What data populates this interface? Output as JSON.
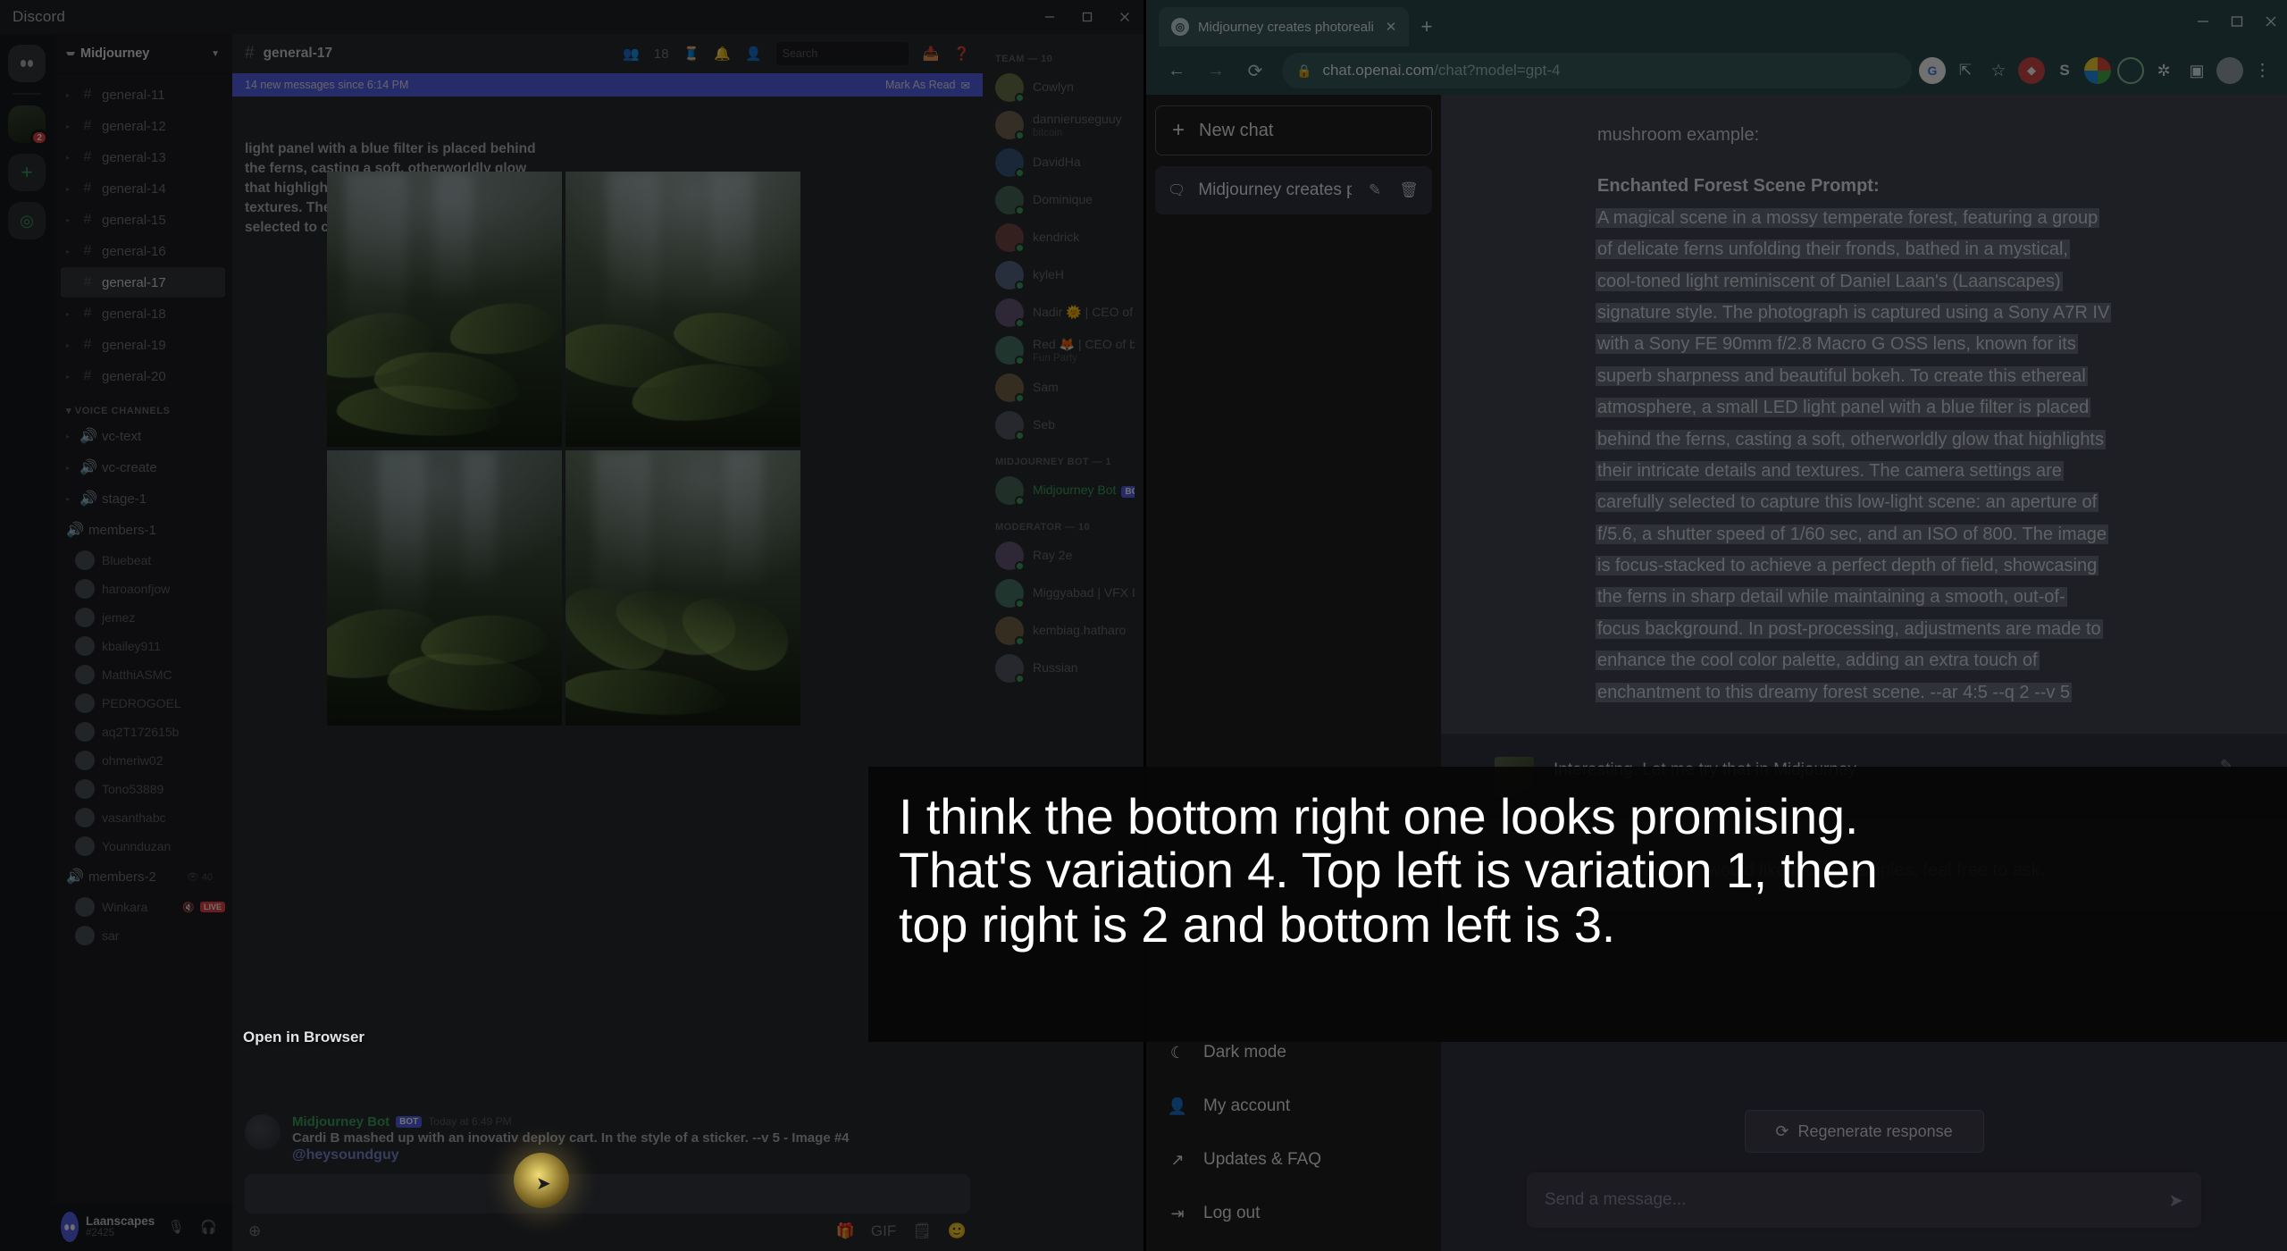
{
  "discord": {
    "window_title": "Discord",
    "window_buttons": [
      "minimize",
      "maximize",
      "close"
    ],
    "server_name": "Midjourney",
    "guild_badge_count": "2",
    "channels_header": "",
    "text_channels": [
      {
        "name": "general-11"
      },
      {
        "name": "general-12"
      },
      {
        "name": "general-13"
      },
      {
        "name": "general-14"
      },
      {
        "name": "general-15"
      },
      {
        "name": "general-16"
      },
      {
        "name": "general-17",
        "active": true
      },
      {
        "name": "general-18"
      },
      {
        "name": "general-19"
      },
      {
        "name": "general-20"
      }
    ],
    "voice_category": "VOICE CHANNELS",
    "voice_channels": [
      {
        "name": "vc-text"
      },
      {
        "name": "vc-create"
      },
      {
        "name": "stage-1"
      }
    ],
    "voice_group_1": {
      "name": "members-1",
      "members": [
        "Bluebeat",
        "haroaonfjow",
        "jemez",
        "kbailey911",
        "MatthiASMC",
        "PEDROGOEL",
        "aq2T172615b",
        "ohmeriw02",
        "Tono53889",
        "vasanthabc",
        "Younnduzan"
      ]
    },
    "voice_group_2": {
      "name": "members-2",
      "count": "40",
      "members": [
        {
          "name": "Winkara",
          "live": "LIVE"
        },
        {
          "name": "sar"
        }
      ]
    },
    "user_panel": {
      "name": "Laanscapes",
      "tag": "#2425",
      "icons": [
        "mic-icon",
        "headset-icon",
        "gear-icon"
      ]
    },
    "channel_header": {
      "name": "general-17",
      "member_count": "18",
      "search_placeholder": "Search"
    },
    "new_messages_banner": {
      "text": "14 new messages since 6:14 PM",
      "action": "Mark As Read"
    },
    "scrollback_text": [
      "light panel with a blue filter is placed behind",
      "the ferns, casting a soft, otherworldly glow",
      "that highlights their intricate details and",
      "textures. The camera settings are carefully",
      "selected to capture this low-light scene; an"
    ],
    "bottom_message": {
      "author": "Midjourney Bot",
      "bot_tag": "BOT",
      "timestamp": "Today at 6:49 PM",
      "body": "Cardi B mashed up with an inovativ deploy cart. In the style of a sticker. --v 5 - Image #4",
      "mention": "@heysoundguy"
    },
    "member_list": {
      "team_header": "TEAM — 10",
      "team": [
        {
          "name": "Cowlyn"
        },
        {
          "name": "dannieruseguuy",
          "sub": "bitcoin"
        },
        {
          "name": "DavidHa"
        },
        {
          "name": "Dominique"
        },
        {
          "name": "kendrick"
        },
        {
          "name": "kyleH"
        },
        {
          "name": "Nadir 🌞 | CEO of bug..."
        },
        {
          "name": "Red 🦊 | CEO of bugs...",
          "sub": "Fun Party"
        },
        {
          "name": "Sam"
        },
        {
          "name": "Seb"
        }
      ],
      "bot_header": "MIDJOURNEY BOT — 1",
      "bots": [
        {
          "name": "Midjourney Bot",
          "tag": "BOT"
        }
      ],
      "mod_header": "MODERATOR — 10",
      "moderators": [
        {
          "name": "Ray 2e"
        },
        {
          "name": "Miggyabad | VFX Dominik"
        },
        {
          "name": "kembiag.hatharo"
        },
        {
          "name": "Russian"
        }
      ]
    },
    "tooltip": "Open in Browser"
  },
  "browser": {
    "tab": {
      "title": "Midjourney creates photorealisti",
      "favicon": "openai-icon",
      "close": "✕"
    },
    "new_tab_label": "+",
    "window_controls": [
      "minimize",
      "maximize",
      "close"
    ],
    "nav": {
      "back": "←",
      "forward": "→",
      "reload": "⟳"
    },
    "omnibox": {
      "lock": "lock-icon",
      "domain": "chat.openai.com",
      "path": "/chat?model=gpt-4"
    },
    "extensions": [
      {
        "name": "google-icon",
        "glyph": "G"
      },
      {
        "name": "share-icon",
        "glyph": "⇪"
      },
      {
        "name": "bookmark-star-icon",
        "glyph": "☆"
      },
      {
        "name": "red-extension-icon",
        "glyph": "◆"
      },
      {
        "name": "s-extension-icon",
        "glyph": "S"
      },
      {
        "name": "color-extension-icon",
        "glyph": ""
      },
      {
        "name": "green-circle-extension-icon",
        "glyph": ""
      },
      {
        "name": "puzzle-extensions-icon",
        "glyph": "🧩"
      },
      {
        "name": "sidepanel-icon",
        "glyph": "▣"
      },
      {
        "name": "profile-avatar",
        "glyph": ""
      },
      {
        "name": "chrome-menu-icon",
        "glyph": "⋮"
      }
    ]
  },
  "chatgpt": {
    "sidebar": {
      "new_chat": "New chat",
      "conversation": {
        "title": "Midjourney creates pho",
        "edit": "edit-icon",
        "delete": "trash-icon"
      },
      "menu": [
        {
          "label": "Dark mode",
          "icon": "moon-icon"
        },
        {
          "label": "My account",
          "icon": "person-icon"
        },
        {
          "label": "Updates & FAQ",
          "icon": "external-link-icon"
        },
        {
          "label": "Log out",
          "icon": "logout-icon"
        }
      ]
    },
    "conversation": {
      "prior_text": "mushroom example:",
      "prompt_heading": "Enchanted Forest Scene Prompt:",
      "prompt_lines": [
        "A magical scene in a mossy temperate forest, featuring a group",
        "of delicate ferns unfolding their fronds, bathed in a mystical,",
        "cool-toned light reminiscent of Daniel Laan's (Laanscapes)",
        "signature style. The photograph is captured using a Sony A7R IV",
        "with a Sony FE 90mm f/2.8 Macro G OSS lens, known for its",
        "superb sharpness and beautiful bokeh. To create this ethereal",
        "atmosphere, a small LED light panel with a blue filter is placed",
        "behind the ferns, casting a soft, otherworldly glow that highlights",
        "their intricate details and textures. The camera settings are",
        "carefully selected to capture this low-light scene: an aperture of",
        "f/5.6, a shutter speed of 1/60 sec, and an ISO of 800. The image",
        "is focus-stacked to achieve a perfect depth of field, showcasing",
        "the ferns in sharp detail while maintaining a smooth, out-of-",
        "focus background. In post-processing, adjustments are made to",
        "enhance the cool color palette, adding an extra touch of",
        "enchantment to this dreamy forest scene. --ar 4:5 --q 2 --v 5"
      ],
      "user_message": "Interesting. Let me try that in Midjourney.",
      "assistant_tail": "assistance or would like more examples, feel free to ask."
    },
    "regenerate_label": "Regenerate response",
    "composer_placeholder": "Send a message...",
    "send_icon": "send-icon"
  },
  "caption": {
    "lines": [
      "I think the bottom right one looks promising.",
      "That's variation 4. Top left is variation 1, then",
      "top right is 2 and bottom left is 3."
    ]
  },
  "colors": {
    "discord_bg": "#2b2d31",
    "browser_accent": "#2d4c4e",
    "chatgpt_bg": "#343541",
    "chatgpt_assistant_bg": "#444654",
    "discord_blurple": "#5865f2",
    "online_green": "#3ba55d",
    "live_red": "#ed4245"
  }
}
